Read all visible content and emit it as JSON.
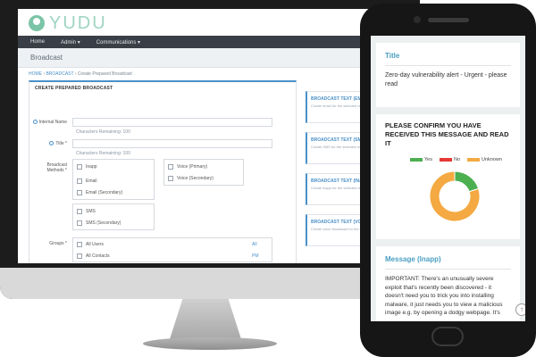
{
  "desktop": {
    "brand": "YUDU",
    "nav": {
      "home": "Home",
      "admin": "Admin ▾",
      "communications": "Communications ▾"
    },
    "page_title": "Broadcast",
    "breadcrumb": {
      "home": "HOME",
      "sep1": "›",
      "broadcast": "BROADCAST",
      "sep2": "›",
      "current": "Create Prepared Broadcast"
    },
    "form": {
      "title": "CREATE PREPARED BROADCAST",
      "internal_name_label": "Internal Name",
      "internal_name_hint": "Characters Remaining: 100",
      "title_label": "Title *",
      "title_hint": "Characters Remaining: 100",
      "broadcast_methods_label": "Broadcast Methods *",
      "methods": [
        "Inapp",
        "Email",
        "Email (Secondary)",
        "SMS",
        "SMS (Secondary)"
      ],
      "voice_methods": [
        "Voice (Primary)",
        "Voice (Secondary)"
      ],
      "groups_label": "Groups *",
      "groups": [
        "All Users",
        "All Contacts"
      ],
      "group_icons": [
        "All",
        "PM"
      ]
    },
    "side_cards": [
      {
        "title": "BROADCAST TEXT (EMAIL)",
        "sub": "Create email for the selected recipients"
      },
      {
        "title": "BROADCAST TEXT (SMS)",
        "sub": "Create SMS for the selected recipients"
      },
      {
        "title": "BROADCAST TEXT (INAPP)",
        "sub": "Create inapp for the selected recipients"
      },
      {
        "title": "BROADCAST TEXT (VOICE)",
        "sub": "Create voice broadcast for the selected"
      }
    ]
  },
  "phone": {
    "title_card": {
      "title": "Title",
      "body": "Zero-day vulnerability alert - Urgent - please read"
    },
    "confirm_card": {
      "heading": "PLEASE CONFIRM YOU HAVE RECEIVED THIS MESSAGE AND READ IT",
      "legend": [
        "Yes",
        "No",
        "Unknown"
      ]
    },
    "message_card": {
      "title": "Message (Inapp)",
      "body": "IMPORTANT: There's an unusually severe exploit that's recently been discovered - it doesn't need you to trick you into installing malware, it just needs you to view a malicious image e.g. by opening a dodgy webpage. It's"
    },
    "scroll_top": "↑"
  },
  "chart_data": {
    "type": "pie",
    "categories": [
      "Yes",
      "No",
      "Unknown"
    ],
    "values": [
      20,
      0,
      80
    ],
    "colors": [
      "#4caf50",
      "#e53935",
      "#f4a942"
    ]
  }
}
